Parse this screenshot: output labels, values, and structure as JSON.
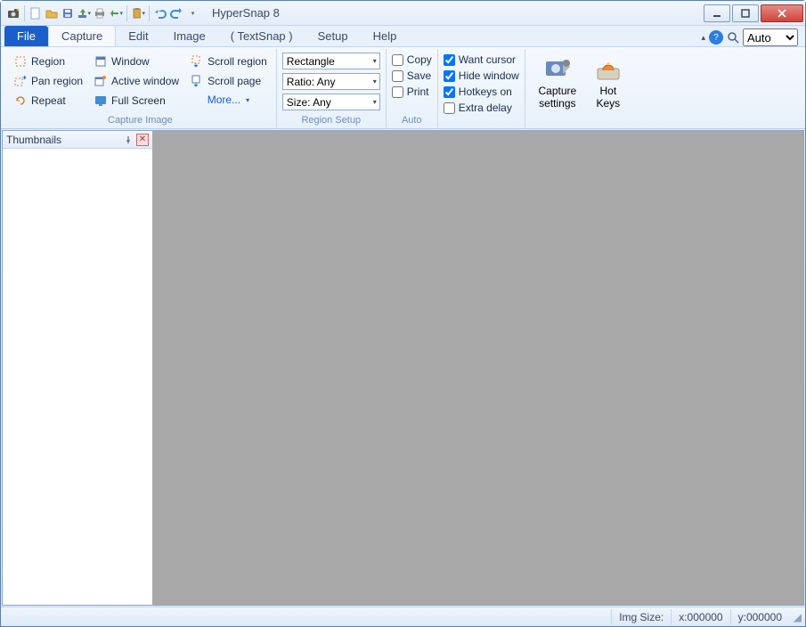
{
  "title": "HyperSnap 8",
  "tabs": {
    "file": "File",
    "capture": "Capture",
    "edit": "Edit",
    "image": "Image",
    "textsnap": "( TextSnap )",
    "setup": "Setup",
    "help": "Help"
  },
  "zoom": "Auto",
  "ribbon": {
    "capture_image": {
      "region": "Region",
      "pan_region": "Pan region",
      "repeat": "Repeat",
      "window": "Window",
      "active_window": "Active window",
      "full_screen": "Full Screen",
      "scroll_region": "Scroll region",
      "scroll_page": "Scroll page",
      "more": "More...",
      "label": "Capture Image"
    },
    "region_setup": {
      "shape": "Rectangle",
      "ratio": "Ratio: Any",
      "size": "Size: Any",
      "label": "Region Setup"
    },
    "auto": {
      "copy": "Copy",
      "save": "Save",
      "print": "Print",
      "label": "Auto"
    },
    "options": {
      "want_cursor": "Want cursor",
      "hide_window": "Hide window",
      "hotkeys_on": "Hotkeys on",
      "extra_delay": "Extra delay"
    },
    "capture_settings": "Capture settings",
    "hot_keys": "Hot Keys"
  },
  "thumbnails": {
    "title": "Thumbnails"
  },
  "status": {
    "img_size": "Img Size:",
    "x": "x:000000",
    "y": "y:000000"
  }
}
